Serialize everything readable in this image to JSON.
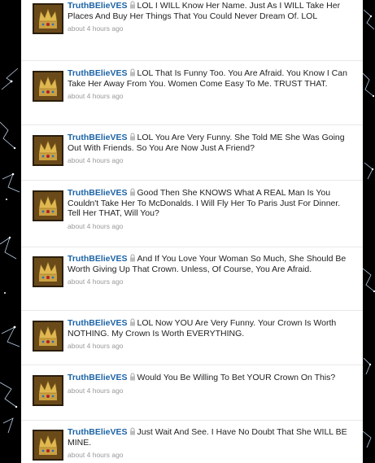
{
  "colors": {
    "screen_name": "#1c63a6",
    "text": "#222222",
    "meta": "#999999",
    "background": "#000000"
  },
  "tweets": [
    {
      "screen_name": "TruthBElieVES",
      "text": "LOL I WILL Know Her Name. Just As I WILL Take Her Places And Buy Her Things That You Could Never Dream Of. LOL",
      "time": "about 4 hours ago",
      "icon": "lock-icon"
    },
    {
      "screen_name": "TruthBElieVES",
      "text": "LOL That Is Funny Too. You Are Afraid. You Know I Can Take Her Away From You. Women Come Easy To Me. TRUST THAT.",
      "time": "about 4 hours ago",
      "icon": "lock-icon"
    },
    {
      "screen_name": "TruthBElieVES",
      "text": "LOL You Are Very Funny. She Told ME She Was Going Out With Friends. So You Are Now Just A Friend?",
      "time": "about 4 hours ago",
      "icon": "lock-icon"
    },
    {
      "screen_name": "TruthBElieVES",
      "text": "Good Then She KNOWS What A REAL Man Is You Couldn't Take Her To McDonalds. I Will Fly Her To Paris Just For Dinner. Tell Her THAT, Will You?",
      "time": "about 4 hours ago",
      "icon": "lock-icon"
    },
    {
      "screen_name": "TruthBElieVES",
      "text": "And If You Love Your Woman So Much, She Should Be Worth Giving Up That Crown. Unless, Of Course, You Are Afraid.",
      "time": "about 4 hours ago",
      "icon": "lock-icon"
    },
    {
      "screen_name": "TruthBElieVES",
      "text": "LOL Now YOU Are Very Funny. Your Crown Is Worth NOTHING. My Crown Is Worth EVERYTHING.",
      "time": "about 4 hours ago",
      "icon": "lock-icon"
    },
    {
      "screen_name": "TruthBElieVES",
      "text": "Would You Be Willing To Bet YOUR Crown On This?",
      "time": "about 4 hours ago",
      "icon": "lock-icon"
    },
    {
      "screen_name": "TruthBElieVES",
      "text": "Just Wait And See. I Have No Doubt That She WILL BE MINE.",
      "time": "about 4 hours ago",
      "icon": "lock-icon"
    }
  ]
}
